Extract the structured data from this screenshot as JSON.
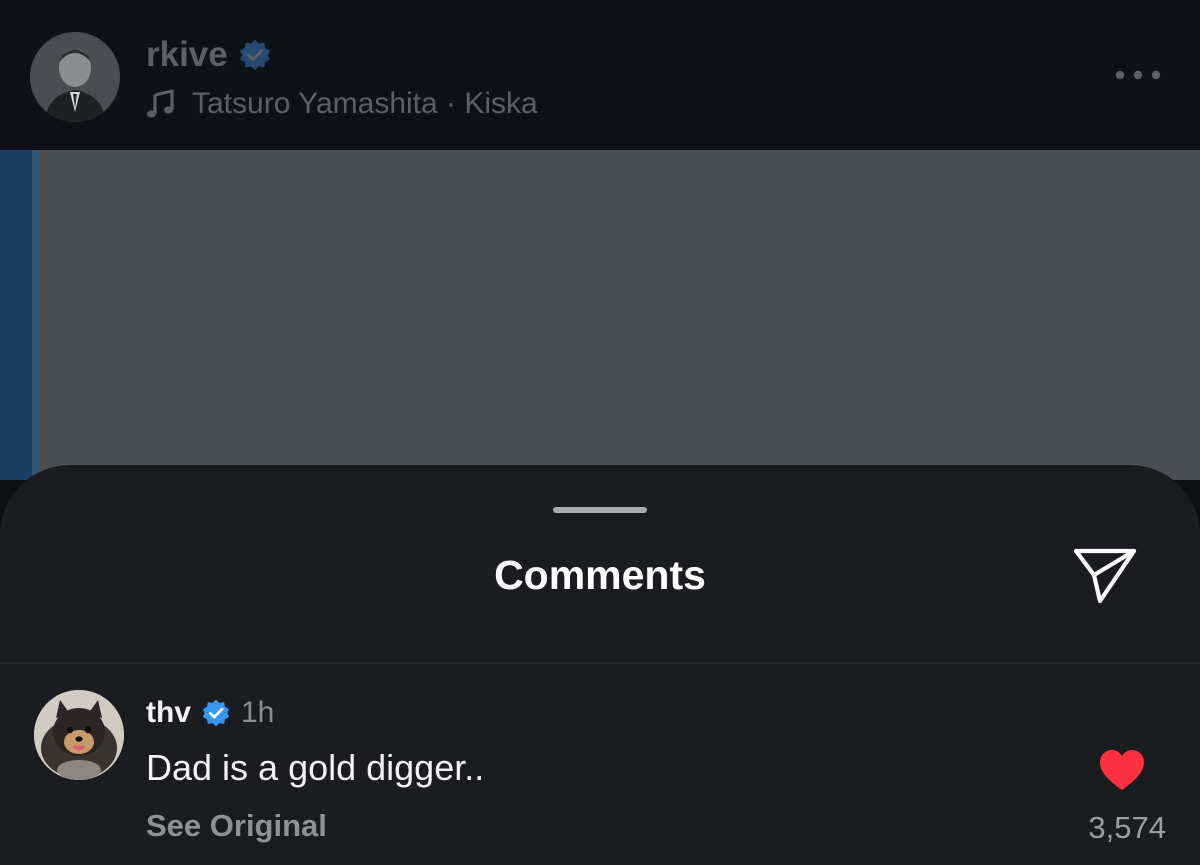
{
  "post": {
    "username": "rkive",
    "music": "Tatsuro Yamashita · Kiska",
    "icons": {
      "avatar": "profile-photo",
      "verified": "verified-badge-icon",
      "music": "music-note-icon",
      "more": "more-horizontal-icon"
    }
  },
  "sheet": {
    "title": "Comments",
    "share_icon": "paper-plane-icon"
  },
  "comment": {
    "username": "thv",
    "time": "1h",
    "text": "Dad is a gold digger..",
    "see_original": "See Original",
    "like_count": "3,574",
    "liked": true,
    "icons": {
      "avatar": "dog-profile-photo",
      "verified": "verified-badge-icon",
      "like": "heart-icon"
    }
  },
  "colors": {
    "verified_blue": "#3897f0",
    "like_red": "#ff3040",
    "sheet_bg": "#1a1c20",
    "header_bg": "#0e1115"
  }
}
